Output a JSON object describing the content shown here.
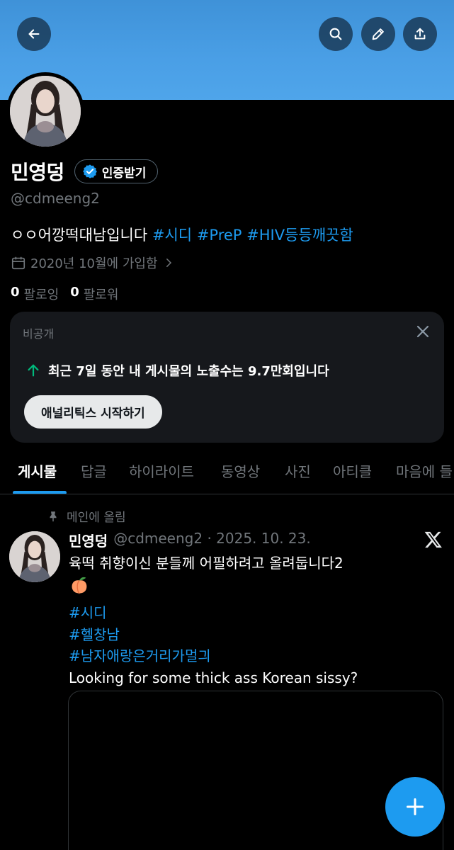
{
  "header": {
    "icons": [
      "arrow-left-icon",
      "search-icon",
      "pencil-icon",
      "share-icon"
    ],
    "banner_color": "#4a9fe6"
  },
  "profile": {
    "name": "민영덩",
    "verify_label": "인증받기",
    "handle": "@cdmeeng2",
    "bio_text": "ㅇㅇ어깡떡대남입니다 ",
    "bio_tags": [
      "#시디",
      "#PreP",
      "#HIV등등깨끗함"
    ],
    "joined": "2020년 10월에 가입함",
    "following_count": "0",
    "following_label": "팔로잉",
    "followers_count": "0",
    "followers_label": "팔로워"
  },
  "analytics_card": {
    "private_label": "비공개",
    "stat_text": "최근 7일 동안 내 게시물의 노출수는 9.7만회입니다",
    "button_label": "애널리틱스 시작하기"
  },
  "tabs": [
    {
      "label": "게시물",
      "active": true
    },
    {
      "label": "답글",
      "active": false
    },
    {
      "label": "하이라이트",
      "active": false
    },
    {
      "label": "동영상",
      "active": false
    },
    {
      "label": "사진",
      "active": false
    },
    {
      "label": "아티클",
      "active": false
    },
    {
      "label": "마음에 들",
      "active": false
    }
  ],
  "post": {
    "pinned_label": "메인에 올림",
    "author_name": "민영덩",
    "meta": "@cdmeeng2 · 2025. 10. 23.",
    "text_line1": "육떡 취향이신 분들께 어필하려고 올려둡니다2",
    "tags": [
      "#시디",
      "#헬창남",
      "#남자애랑은거리가멀긔"
    ],
    "text_line2": "Looking for some thick ass Korean sissy?"
  },
  "colors": {
    "accent": "#1d9bf0",
    "background": "#000000",
    "muted": "#71767b",
    "card": "#16181c",
    "up_arrow": "#00ba7c"
  }
}
